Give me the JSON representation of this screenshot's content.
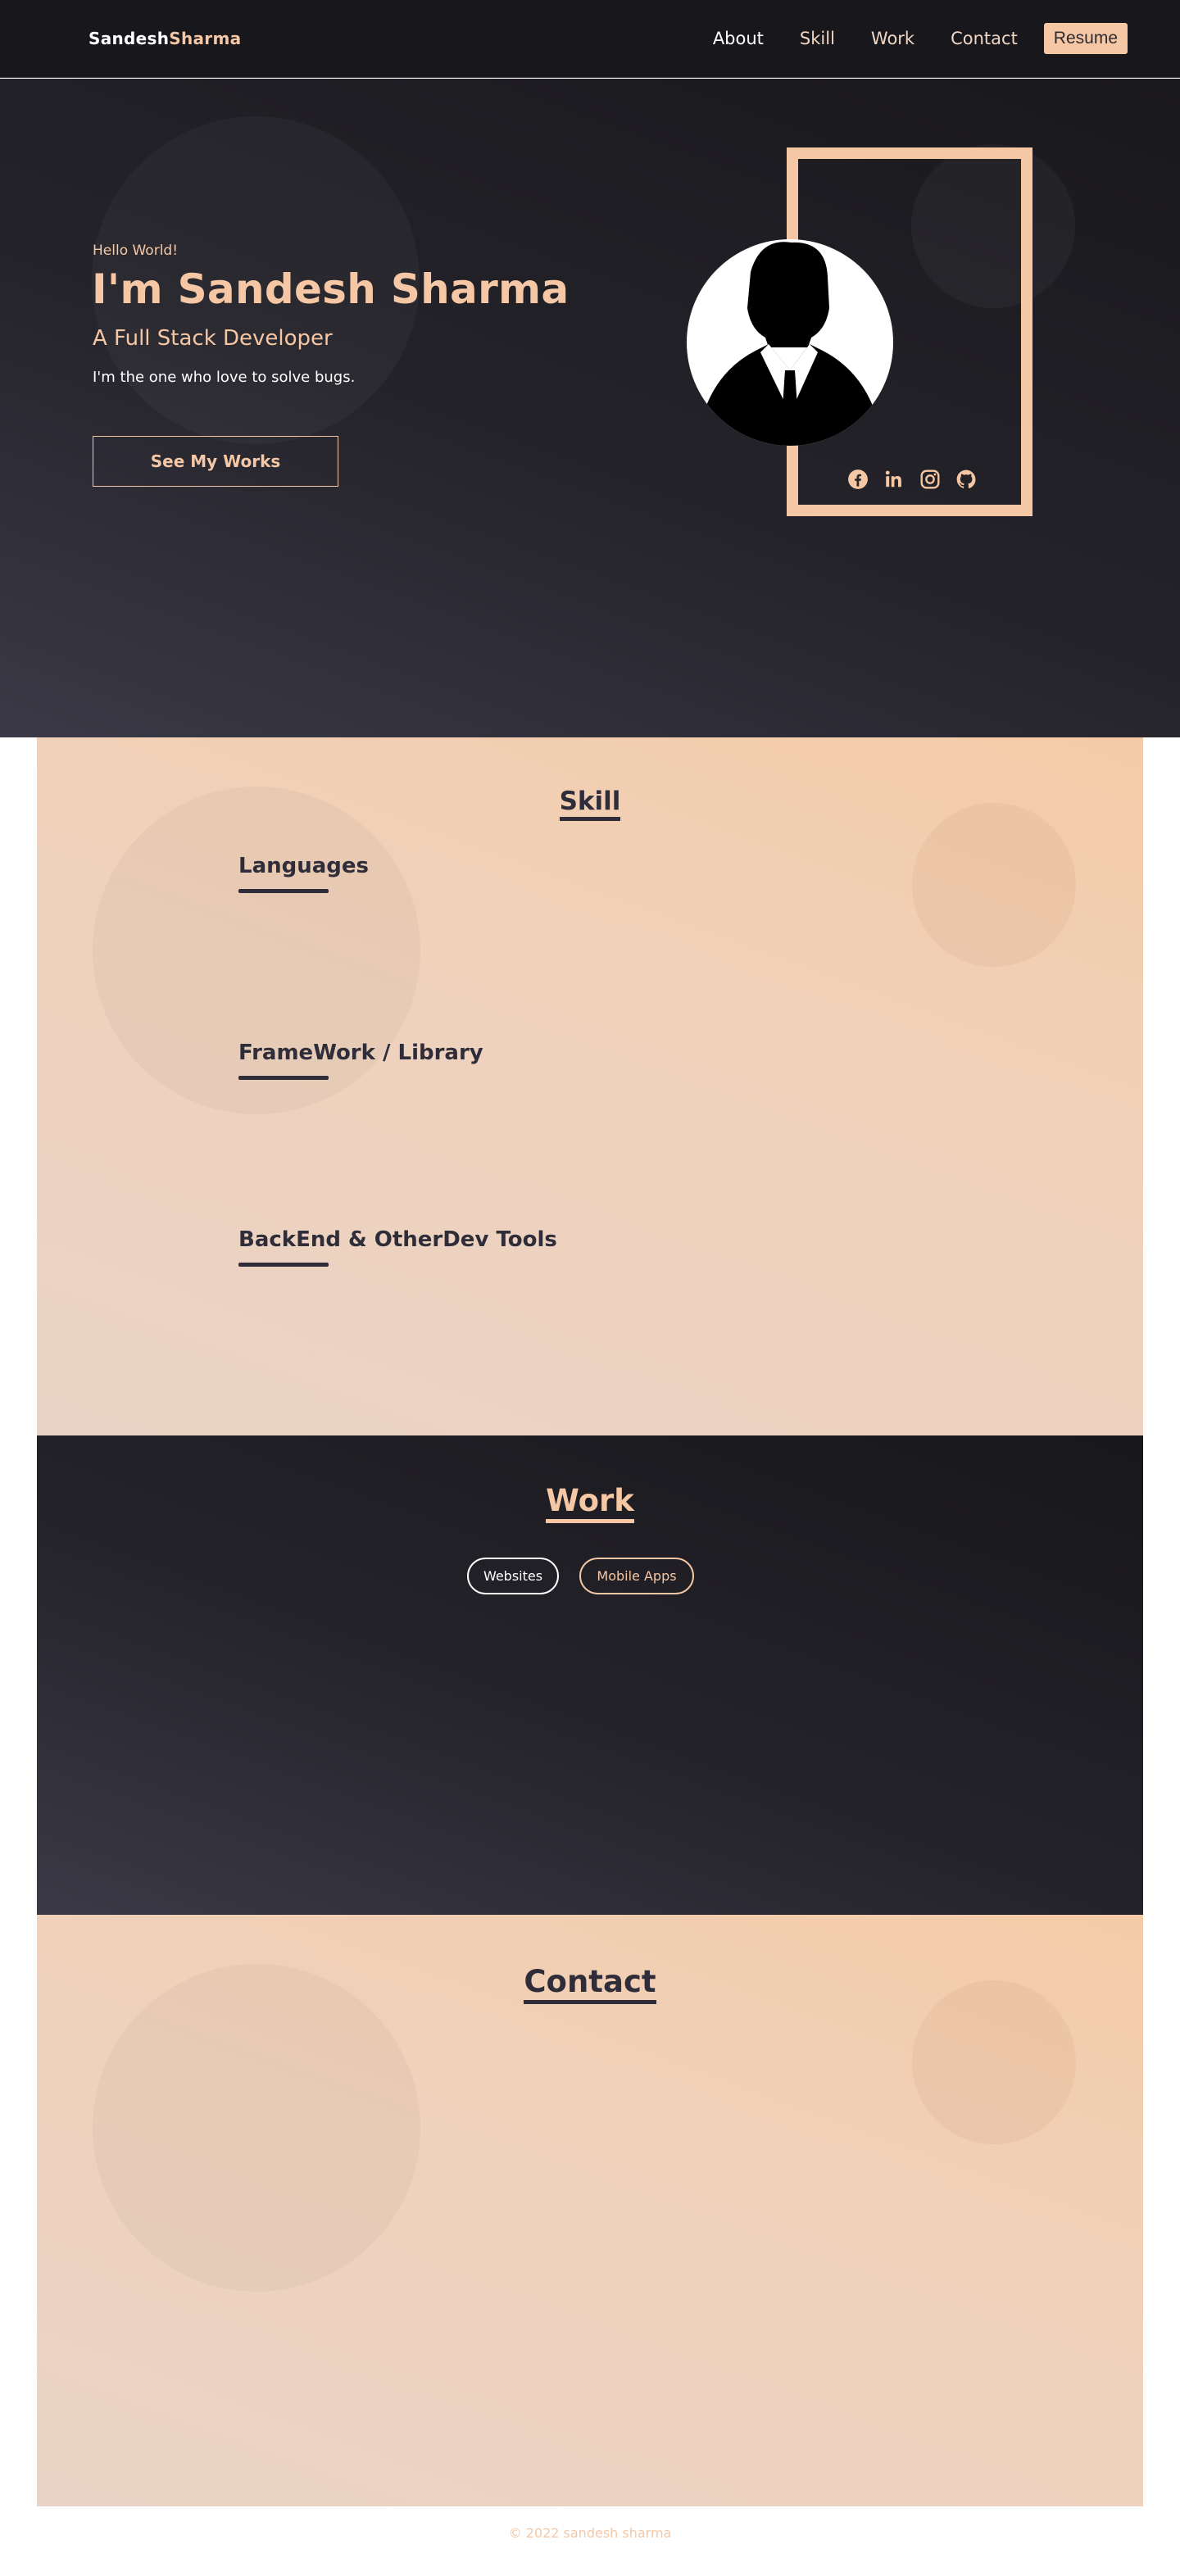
{
  "nav": {
    "brand_first": "Sandesh",
    "brand_second": "Sharma",
    "links": [
      "About",
      "Skill",
      "Work",
      "Contact"
    ],
    "resume_label": "Resume"
  },
  "hero": {
    "greeting": "Hello World!",
    "name": "I'm Sandesh Sharma",
    "role": "A Full Stack Developer",
    "tagline": "I'm the one who love to solve bugs.",
    "cta_label": "See My Works",
    "socials": [
      "facebook-icon",
      "linkedin-icon",
      "instagram-icon",
      "github-icon"
    ]
  },
  "skill": {
    "title": "Skill",
    "categories": [
      "Languages",
      "FrameWork / Library",
      "BackEnd & OtherDev Tools"
    ]
  },
  "work": {
    "title": "Work",
    "filters": [
      "Websites",
      "Mobile Apps"
    ]
  },
  "contact": {
    "title": "Contact"
  },
  "footer": {
    "text": "© 2022 sandesh sharma"
  },
  "colors": {
    "accent": "#f5c7a4",
    "dark": "#18171b",
    "text_dark": "#2f2d3a"
  }
}
